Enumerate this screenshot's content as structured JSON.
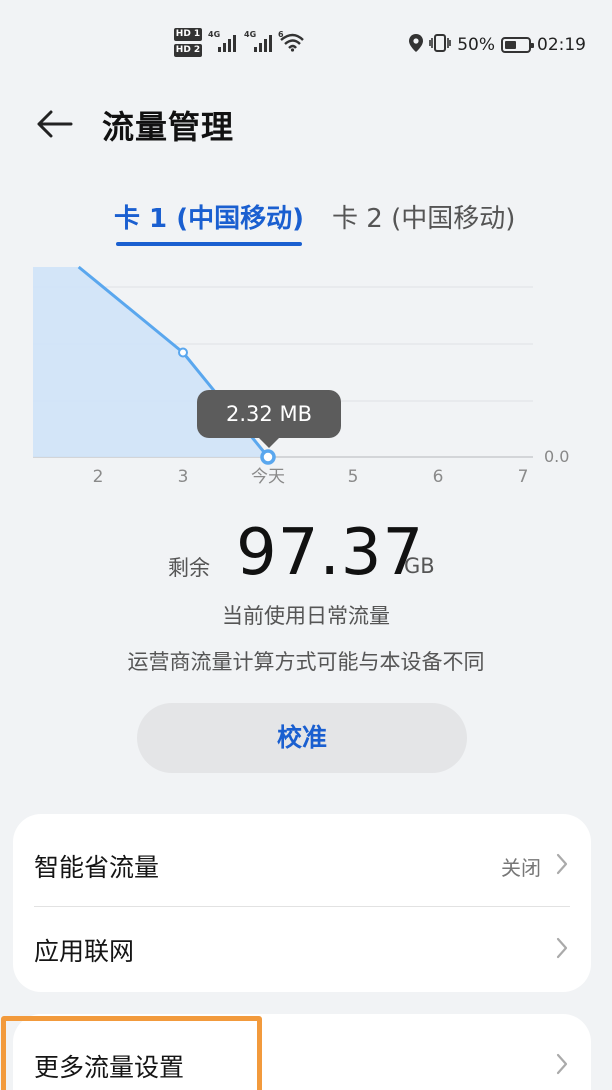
{
  "status_bar": {
    "sim1_badge": "HD 1",
    "sim2_badge": "HD 2",
    "signal1_label": "4G",
    "signal2_label": "4G",
    "wifi_label": "6",
    "battery_percent": "50%",
    "battery_level": 0.5,
    "time": "02:19"
  },
  "header": {
    "title": "流量管理"
  },
  "tabs": [
    {
      "label": "卡 1 (中国移动)",
      "active": true
    },
    {
      "label": "卡 2 (中国移动)",
      "active": false
    }
  ],
  "chart_data": {
    "type": "area",
    "categories": [
      "2",
      "3",
      "今天",
      "5",
      "6",
      "7"
    ],
    "series": [
      {
        "values": [
          5.5,
          3.3,
          0.0,
          null,
          null,
          null
        ]
      }
    ],
    "tooltip": "2.32 MB",
    "y_baseline_label": "0.0",
    "accent_color": "#5aa7ee",
    "fill_color": "#cfe3f8",
    "grid": true
  },
  "remaining": {
    "label": "剩余",
    "value": "97.37",
    "unit": "GB",
    "subtitle": "当前使用日常流量",
    "note": "运营商流量计算方式可能与本设备不同"
  },
  "calibrate_label": "校准",
  "settings": {
    "card1": [
      {
        "label": "智能省流量",
        "value": "关闭"
      },
      {
        "label": "应用联网",
        "value": ""
      }
    ],
    "card2": [
      {
        "label": "更多流量设置",
        "value": ""
      }
    ]
  },
  "colors": {
    "accent": "#1a5fd0",
    "background": "#f1f3f5",
    "highlight": "#f29a3c"
  }
}
